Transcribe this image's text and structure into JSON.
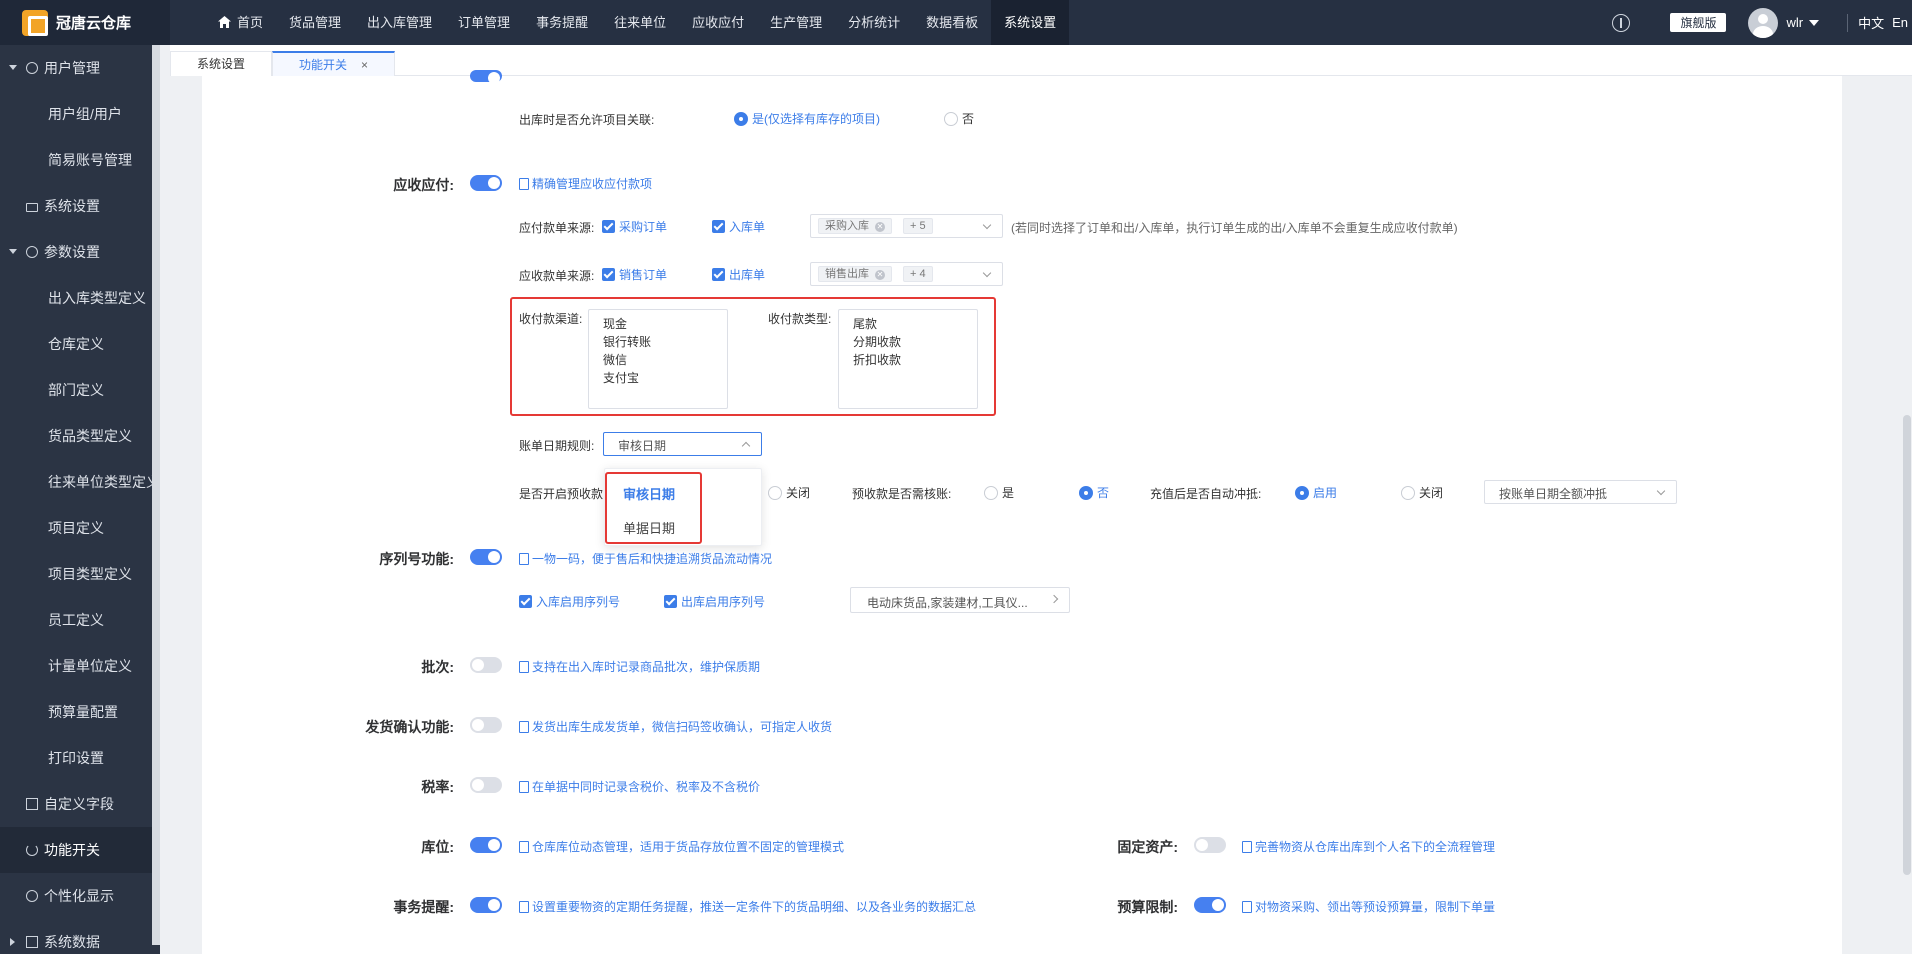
{
  "app": {
    "logo_text": "冠唐云仓库"
  },
  "nav": {
    "items": [
      "首页",
      "货品管理",
      "出入库管理",
      "订单管理",
      "事务提醒",
      "往来单位",
      "应收应付",
      "生产管理",
      "分析统计",
      "数据看板",
      "系统设置"
    ],
    "active_index": 10
  },
  "header": {
    "edition": "旗舰版",
    "username": "wlr",
    "language": "中文",
    "lang_extra": "En"
  },
  "sidebar": {
    "items": [
      {
        "label": "用户管理",
        "level": 1,
        "icon": "user-icon"
      },
      {
        "label": "用户组/用户",
        "level": 2
      },
      {
        "label": "简易账号管理",
        "level": 2
      },
      {
        "label": "系统设置",
        "level": 1,
        "icon": "monitor-icon"
      },
      {
        "label": "参数设置",
        "level": 1,
        "icon": "gear-icon"
      },
      {
        "label": "出入库类型定义",
        "level": 2
      },
      {
        "label": "仓库定义",
        "level": 2
      },
      {
        "label": "部门定义",
        "level": 2
      },
      {
        "label": "货品类型定义",
        "level": 2
      },
      {
        "label": "往来单位类型定义",
        "level": 2
      },
      {
        "label": "项目定义",
        "level": 2
      },
      {
        "label": "项目类型定义",
        "level": 2
      },
      {
        "label": "员工定义",
        "level": 2
      },
      {
        "label": "计量单位定义",
        "level": 2
      },
      {
        "label": "预算量配置",
        "level": 2
      },
      {
        "label": "打印设置",
        "level": 2
      },
      {
        "label": "自定义字段",
        "level": 1,
        "icon": "document-icon"
      },
      {
        "label": "功能开关",
        "level": 1,
        "icon": "power-icon"
      },
      {
        "label": "个性化显示",
        "level": 1,
        "icon": "gear-icon"
      },
      {
        "label": "系统数据",
        "level": 1,
        "icon": "folder-icon"
      }
    ]
  },
  "tabs": {
    "items": [
      "系统设置",
      "功能开关"
    ],
    "active_index": 1,
    "close": "×"
  },
  "content": {
    "project": {
      "outbound_label": "出库时是否允许项目关联:",
      "opt_yes": "是(仅选择有库存的项目)",
      "opt_no": "否"
    },
    "receivable": {
      "label": "应收应付:",
      "desc": "精确管理应收应付款项",
      "payable_source_label": "应付款单来源:",
      "payable_opt1": "采购订单",
      "payable_opt2": "入库单",
      "payable_tag": "采购入库",
      "payable_more": "+ 5",
      "note": "(若同时选择了订单和出/入库单，执行订单生成的出/入库单不会重复生成应收付款单)",
      "receivable_source_label": "应收款单来源:",
      "receivable_opt1": "销售订单",
      "receivable_opt2": "出库单",
      "receivable_tag": "销售出库",
      "receivable_more": "+ 4",
      "channel_label": "收付款渠道:",
      "channels": [
        "现金",
        "银行转账",
        "微信",
        "支付宝"
      ],
      "type_label": "收付款类型:",
      "types": [
        "尾款",
        "分期收款",
        "折扣收款"
      ],
      "bill_date_label": "账单日期规则:",
      "bill_date_value": "审核日期",
      "dropdown_options": [
        "审核日期",
        "单据日期"
      ],
      "prepay_label": "是否开启预收款",
      "prepay_close": "关闭",
      "prepay_verify_label": "预收款是否需核账:",
      "yes": "是",
      "no": "否",
      "recharge_label": "充值后是否自动冲抵:",
      "enable": "启用",
      "close": "关闭",
      "offset_select": "按账单日期全额冲抵"
    },
    "serial": {
      "label": "序列号功能:",
      "desc": "一物一码，便于售后和快捷追溯货品流动情况",
      "opt1": "入库启用序列号",
      "opt2": "出库启用序列号",
      "select": "电动床货品,家装建材,工具仪..."
    },
    "batch": {
      "label": "批次:",
      "desc": "支持在出入库时记录商品批次，维护保质期"
    },
    "delivery": {
      "label": "发货确认功能:",
      "desc": "发货出库生成发货单，微信扫码签收确认，可指定人收货"
    },
    "tax": {
      "label": "税率:",
      "desc": "在单据中同时记录含税价、税率及不含税价"
    },
    "location": {
      "label": "库位:",
      "desc": "仓库库位动态管理，适用于货品存放位置不固定的管理模式"
    },
    "fixed_asset": {
      "label": "固定资产:",
      "desc": "完善物资从仓库出库到个人名下的全流程管理"
    },
    "reminder": {
      "label": "事务提醒:",
      "desc": "设置重要物资的定期任务提醒，推送一定条件下的货品明细、以及各业务的数据汇总"
    },
    "budget": {
      "label": "预算限制:",
      "desc": "对物资采购、领出等预设预算量，限制下单量"
    }
  },
  "colors": {
    "accent": "#3c7de8",
    "topbar": "#263042",
    "sidebar": "#2b3444",
    "highlight": "#e53935"
  }
}
